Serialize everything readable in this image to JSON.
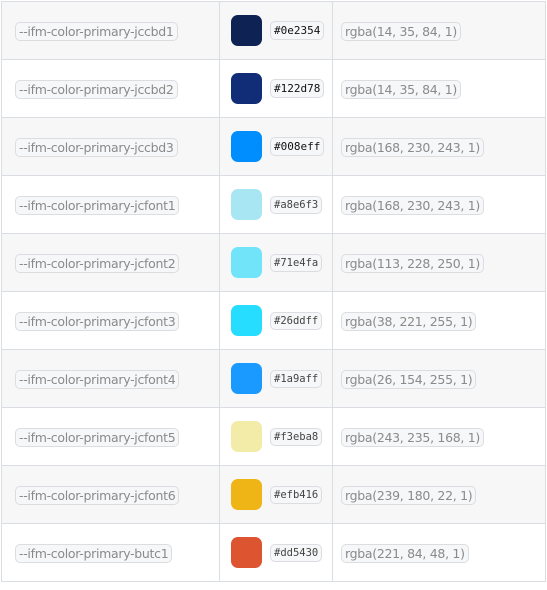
{
  "rows": [
    {
      "name": "--ifm-color-primary-jccbd1",
      "hex": "#0e2354",
      "swatch": "#0e2354",
      "rgba": "rgba(14, 35, 84, 1)"
    },
    {
      "name": "--ifm-color-primary-jccbd2",
      "hex": "#122d78",
      "swatch": "#122d78",
      "rgba": "rgba(14, 35, 84, 1)"
    },
    {
      "name": "--ifm-color-primary-jccbd3",
      "hex": "#008eff",
      "swatch": "#008eff",
      "rgba": "rgba(168, 230, 243, 1)"
    },
    {
      "name": "--ifm-color-primary-jcfont1",
      "hex": "#a8e6f3",
      "swatch": "#a8e6f3",
      "rgba": "rgba(168, 230, 243, 1)"
    },
    {
      "name": "--ifm-color-primary-jcfont2",
      "hex": "#71e4fa",
      "swatch": "#71e4fa",
      "rgba": "rgba(113, 228, 250, 1)"
    },
    {
      "name": "--ifm-color-primary-jcfont3",
      "hex": "#26ddff",
      "swatch": "#26ddff",
      "rgba": "rgba(38, 221, 255, 1)"
    },
    {
      "name": "--ifm-color-primary-jcfont4",
      "hex": "#1a9aff",
      "swatch": "#1a9aff",
      "rgba": "rgba(26, 154, 255, 1)"
    },
    {
      "name": "--ifm-color-primary-jcfont5",
      "hex": "#f3eba8",
      "swatch": "#f3eba8",
      "rgba": "rgba(243, 235, 168, 1)"
    },
    {
      "name": "--ifm-color-primary-jcfont6",
      "hex": "#efb416",
      "swatch": "#efb416",
      "rgba": "rgba(239, 180, 22, 1)"
    },
    {
      "name": "--ifm-color-primary-butc1",
      "hex": "#dd5430",
      "swatch": "#dd5430",
      "rgba": "rgba(221, 84, 48, 1)"
    }
  ]
}
